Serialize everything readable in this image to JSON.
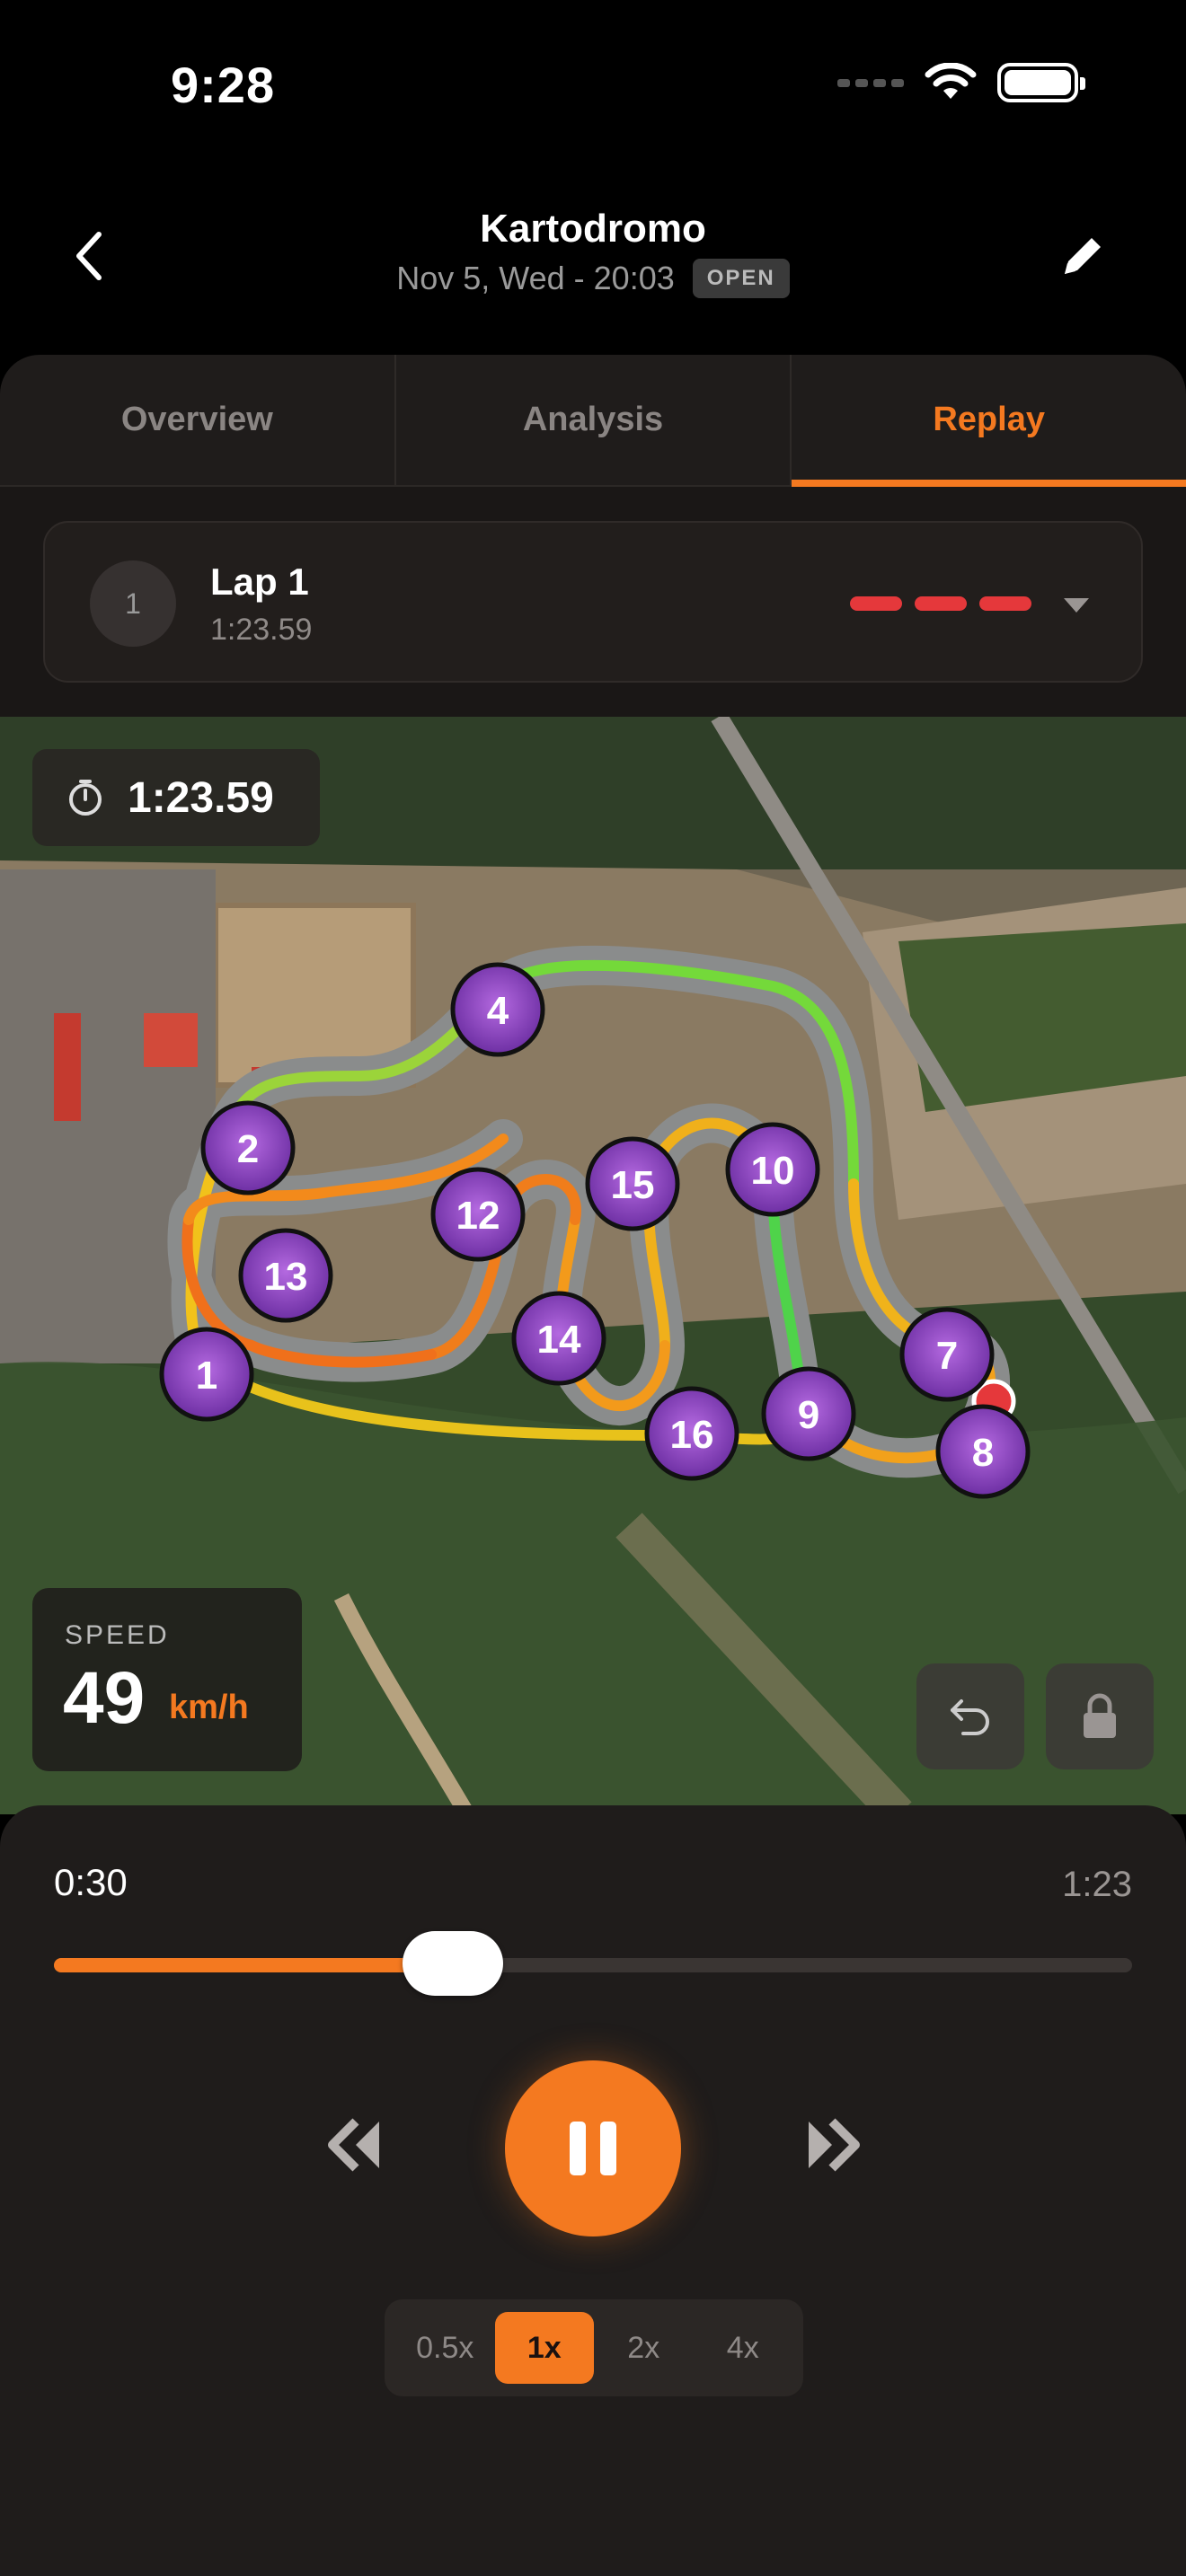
{
  "status_bar": {
    "time": "9:28"
  },
  "header": {
    "title": "Kartodromo",
    "subtitle": "Nov 5, Wed - 20:03",
    "badge": "OPEN",
    "back_icon": "chevron-left-icon",
    "edit_icon": "pencil-icon"
  },
  "tabs": [
    {
      "label": "Overview",
      "active": false
    },
    {
      "label": "Analysis",
      "active": false
    },
    {
      "label": "Replay",
      "active": true
    }
  ],
  "lap": {
    "number": "1",
    "title": "Lap 1",
    "time": "1:23.59",
    "sector_colors": [
      "#e5383b",
      "#e5383b",
      "#e5383b"
    ]
  },
  "map": {
    "lap_timer": "1:23.59",
    "speed_label": "SPEED",
    "speed_value": "49",
    "speed_unit": "km/h",
    "corners": [
      "1",
      "2",
      "4",
      "7",
      "8",
      "9",
      "10",
      "12",
      "13",
      "14",
      "15",
      "16"
    ]
  },
  "player": {
    "position": "0:30",
    "duration": "1:23",
    "progress": 0.37,
    "speeds": [
      {
        "label": "0.5x",
        "active": false
      },
      {
        "label": "1x",
        "active": true
      },
      {
        "label": "2x",
        "active": false
      },
      {
        "label": "4x",
        "active": false
      }
    ]
  },
  "colors": {
    "accent": "#f47920",
    "corner": "#8e44c2",
    "sector": "#e5383b"
  }
}
